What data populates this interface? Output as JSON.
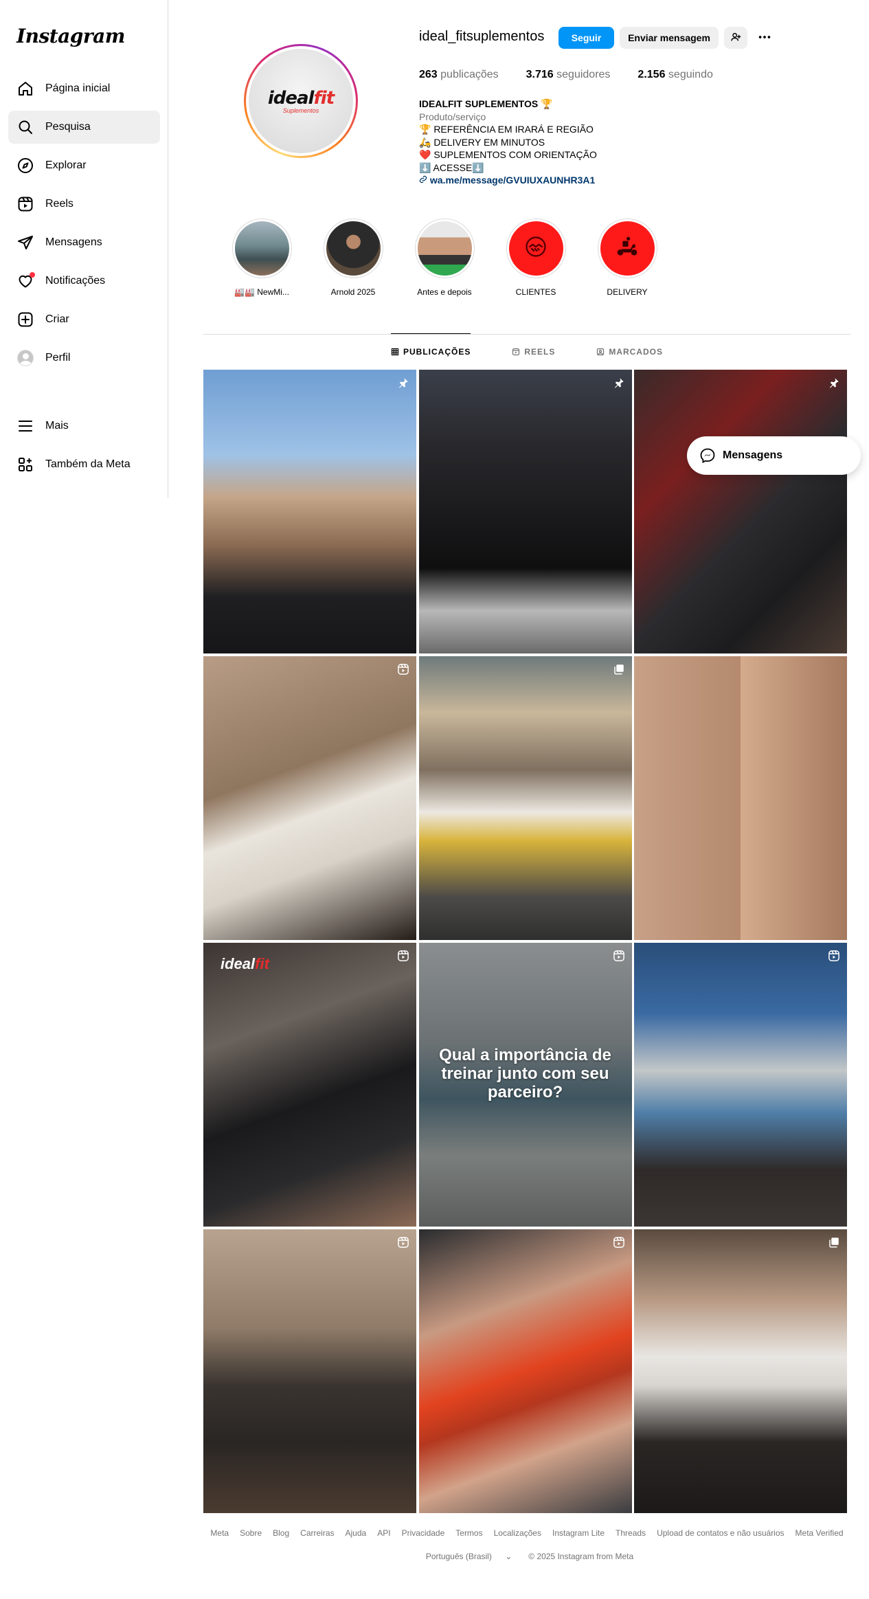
{
  "app": {
    "logo_text": "Instagram"
  },
  "sidebar": {
    "items": [
      {
        "label": "Página inicial",
        "icon": "home-icon"
      },
      {
        "label": "Pesquisa",
        "icon": "search-icon"
      },
      {
        "label": "Explorar",
        "icon": "compass-icon"
      },
      {
        "label": "Reels",
        "icon": "reels-icon"
      },
      {
        "label": "Mensagens",
        "icon": "send-icon"
      },
      {
        "label": "Notificações",
        "icon": "heart-icon"
      },
      {
        "label": "Criar",
        "icon": "plus-square-icon"
      },
      {
        "label": "Perfil",
        "icon": "avatar"
      }
    ],
    "lower": [
      {
        "label": "Mais",
        "icon": "menu-icon"
      },
      {
        "label": "Também da Meta",
        "icon": "meta-apps-icon"
      }
    ]
  },
  "profile": {
    "username": "ideal_fitsuplementos",
    "pic_brand_main": "ideal",
    "pic_brand_accent": "fit",
    "pic_brand_sub": "Suplementos",
    "buttons": {
      "follow": "Seguir",
      "message": "Enviar mensagem"
    },
    "stats": {
      "posts_count": "263",
      "posts_label": " publicações",
      "followers_count": "3.716",
      "followers_label": " seguidores",
      "following_count": "2.156",
      "following_label": " seguindo"
    },
    "bio": {
      "name": "IDEALFIT SUPLEMENTOS 🏆",
      "category": "Produto/serviço",
      "lines": [
        "🏆 REFERÊNCIA EM IRARÁ E REGIÃO",
        "🛵 DELIVERY EM MINUTOS",
        "❤️ SUPLEMENTOS COM ORIENTAÇÃO",
        "⬇️ ACESSE⬇️"
      ],
      "link": "wa.me/message/GVUIUXAUNHR3A1"
    }
  },
  "highlights": [
    {
      "label": "🏭🏭 NewMi..."
    },
    {
      "label": "Arnold 2025"
    },
    {
      "label": "Antes e depois"
    },
    {
      "label": "CLIENTES"
    },
    {
      "label": "DELIVERY"
    }
  ],
  "tabs": [
    {
      "label": "PUBLICAÇÕES"
    },
    {
      "label": "REELS"
    },
    {
      "label": "MARCADOS"
    }
  ],
  "posts": {
    "reel_text": "Qual a importância de treinar junto com seu parceiro?",
    "brand_main": "ideal",
    "brand_accent": "fit"
  },
  "messages_pill": {
    "label": "Mensagens"
  },
  "footer": {
    "links": [
      "Meta",
      "Sobre",
      "Blog",
      "Carreiras",
      "Ajuda",
      "API",
      "Privacidade",
      "Termos",
      "Localizações",
      "Instagram Lite",
      "Threads",
      "Upload de contatos e não usuários",
      "Meta Verified"
    ],
    "language": "Português (Brasil)",
    "copyright": "© 2025 Instagram from Meta"
  },
  "colors": {
    "primary": "#0095f6",
    "link": "#00376b",
    "muted": "#737373",
    "notification": "#ff3040"
  }
}
